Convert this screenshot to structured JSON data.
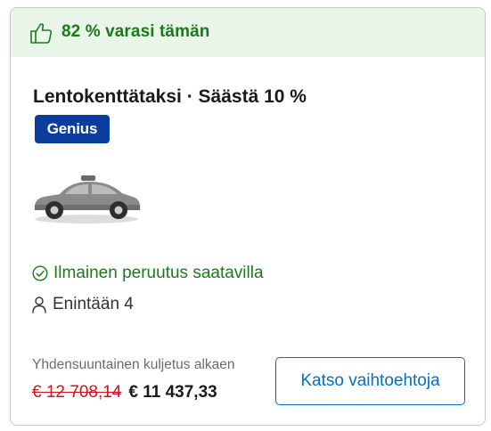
{
  "banner": {
    "icon": "thumbs-up-icon",
    "text": "82 % varasi tämän"
  },
  "offer": {
    "title": "Lentokenttätaksi · Säästä 10 %",
    "badge": "Genius",
    "vehicle_icon": "car-icon",
    "cancellation": {
      "icon": "check-circle-icon",
      "text": "Ilmainen peruutus saatavilla"
    },
    "passengers": {
      "icon": "person-icon",
      "text": "Enintään 4"
    }
  },
  "pricing": {
    "caption": "Yhdensuuntainen kuljetus alkaen",
    "old_price": "€ 12 708,14",
    "new_price": "€ 11 437,33"
  },
  "actions": {
    "view_options_label": "Katso vaihtoehtoja"
  },
  "colors": {
    "banner_bg": "#eaf5ea",
    "success_green": "#1a7a1a",
    "genius_blue": "#0a3e9e",
    "link_blue": "#0071c2",
    "strike_red": "#d4111e"
  }
}
